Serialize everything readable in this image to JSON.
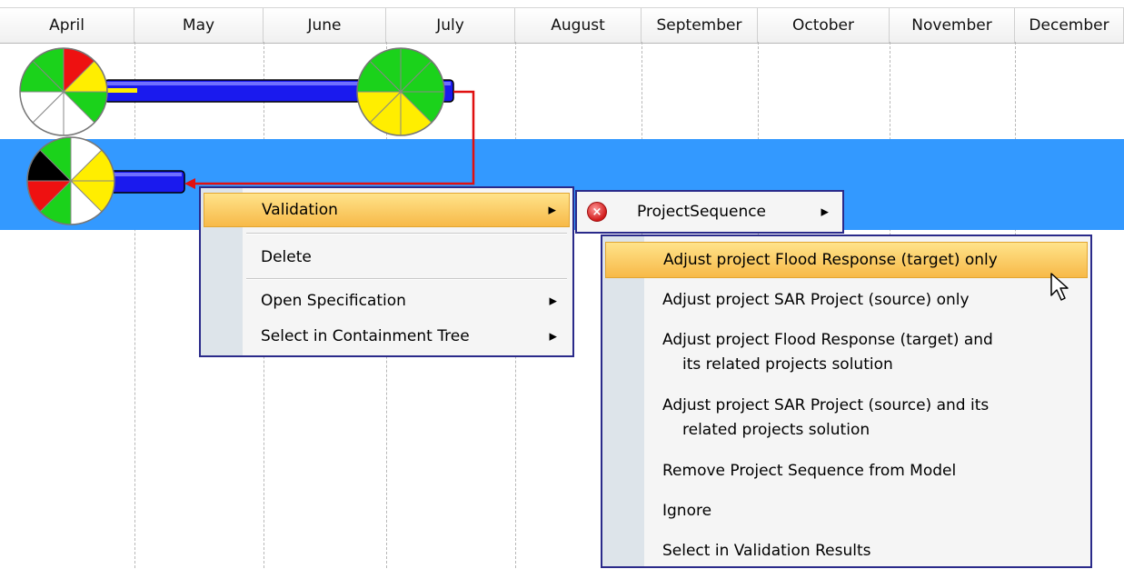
{
  "timeline": {
    "months": [
      "April",
      "May",
      "June",
      "July",
      "August",
      "September",
      "October",
      "November",
      "December"
    ]
  },
  "context_menu": {
    "items": [
      {
        "label": "Validation",
        "has_submenu": true,
        "highlighted": true
      },
      {
        "label": "Delete",
        "has_submenu": false
      },
      {
        "label": "Open Specification",
        "has_submenu": true
      },
      {
        "label": "Select in Containment Tree",
        "has_submenu": true
      }
    ]
  },
  "validation_submenu": {
    "rule_label": "ProjectSequence",
    "rule_icon": "error-icon"
  },
  "solutions_menu": {
    "items": [
      {
        "lines": [
          "Adjust project Flood Response (target) only"
        ],
        "highlighted": true
      },
      {
        "lines": [
          "Adjust project SAR Project (source) only"
        ]
      },
      {
        "lines": [
          "Adjust project Flood Response (target) and",
          "its related projects solution"
        ]
      },
      {
        "lines": [
          "Adjust project SAR Project (source) and its",
          "related projects solution"
        ]
      },
      {
        "lines": [
          "Remove Project Sequence from Model"
        ]
      },
      {
        "lines": [
          "Ignore"
        ]
      },
      {
        "lines": [
          "Select in Validation Results"
        ]
      }
    ]
  },
  "colors": {
    "selection_band": "#3399ff",
    "bar": "#1a1aee",
    "dependency_arrow": "#e01010",
    "menu_highlight": "#f7c04a"
  }
}
